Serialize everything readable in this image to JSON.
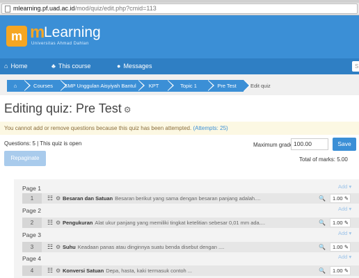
{
  "browser": {
    "url_host": "mlearning.pf.uad.ac.id",
    "url_path": "/mod/quiz/edit.php?cmid=113"
  },
  "brand": {
    "logo_letter": "m",
    "logo_m": "m",
    "logo_rest": "Learning",
    "logo_subtitle": "Universitas Ahmad Dahlan",
    "header_color": "#3b8fd6",
    "accent_color": "#f5a623"
  },
  "nav": {
    "home": "Home",
    "this_course": "This course",
    "messages": "Messages",
    "search_placeholder": "S"
  },
  "breadcrumb": {
    "home_icon": "home-icon",
    "items": [
      "Courses",
      "SMP Unggulan Aisyiyah Bantul",
      "KPT",
      "Topic 1",
      "Pre Test"
    ],
    "current": "Edit quiz"
  },
  "page": {
    "title": "Editing quiz: Pre Test"
  },
  "warning": {
    "text": "You cannot add or remove questions because this quiz has been attempted.",
    "link": "(Attempts: 25)"
  },
  "quiz": {
    "info": "Questions: 5 | This quiz is open",
    "max_grade_label": "Maximum grade:",
    "max_grade_value": "100.00",
    "save_label": "Save",
    "repaginate_label": "Repaginate",
    "total_marks": "Total of marks: 5.00",
    "add_label": "Add"
  },
  "pages": [
    {
      "label": "Page 1",
      "num": "1",
      "name": "Besaran dan Satuan",
      "text": "Besaran berikut yang sama dengan besaran panjang adalah....",
      "mark": "1.00"
    },
    {
      "label": "Page 2",
      "num": "2",
      "name": "Pengukuran",
      "text": "Alat ukur panjang yang memiliki tingkat ketelitian sebesar 0,01 mm ada....",
      "mark": "1.00"
    },
    {
      "label": "Page 3",
      "num": "3",
      "name": "Suhu",
      "text": "Keadaan panas atau dinginnya suatu benda disebut dengan ....",
      "mark": "1.00"
    },
    {
      "label": "Page 4",
      "num": "4",
      "name": "Konversi Satuan",
      "text": "Depa, hasta, kaki termasuk contoh ...",
      "mark": "1.00"
    }
  ]
}
